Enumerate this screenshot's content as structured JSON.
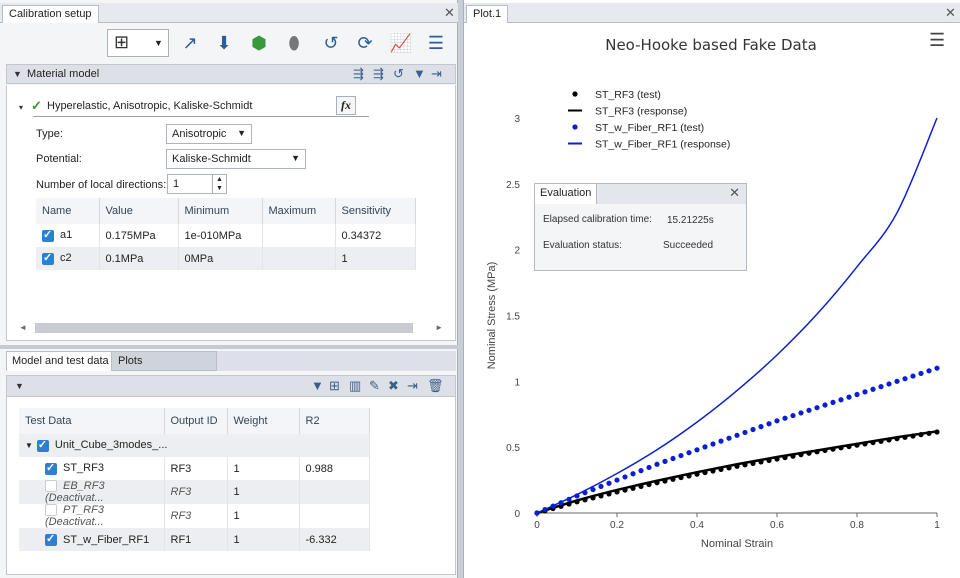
{
  "left_panel": {
    "tab_title": "Calibration setup",
    "material_model": {
      "section_title": "Material model",
      "model_name": "Hyperelastic, Anisotropic, Kaliske-Schmidt",
      "fx_label": "fx",
      "type_label": "Type:",
      "type_value": "Anisotropic",
      "potential_label": "Potential:",
      "potential_value": "Kaliske-Schmidt",
      "local_dirs_label": "Number of local directions:",
      "local_dirs_value": "1",
      "columns": [
        "Name",
        "Value",
        "Minimum",
        "Maximum",
        "Sensitivity"
      ],
      "rows": [
        {
          "name": "a1",
          "value": "0.175MPa",
          "minimum": "1e-010MPa",
          "maximum": "",
          "sensitivity": "0.34372"
        },
        {
          "name": "c2",
          "value": "0.1MPa",
          "minimum": "0MPa",
          "maximum": "",
          "sensitivity": "1"
        }
      ]
    },
    "bottom_tabs": [
      "Model and test data",
      "Plots"
    ],
    "test_data": {
      "columns": [
        "Test Data",
        "Output ID",
        "Weight",
        "R2"
      ],
      "group_name": "Unit_Cube_3modes_...",
      "rows": [
        {
          "name": "ST_RF3",
          "output": "RF3",
          "weight": "1",
          "r2": "0.988",
          "checked": true
        },
        {
          "name": "EB_RF3 (Deactivat...",
          "output": "RF3",
          "weight": "1",
          "r2": "",
          "checked": false
        },
        {
          "name": "PT_RF3 (Deactivat...",
          "output": "RF3",
          "weight": "1",
          "r2": "",
          "checked": false
        },
        {
          "name": "ST_w_Fiber_RF1",
          "output": "RF1",
          "weight": "1",
          "r2": "-6.332",
          "checked": true
        }
      ]
    }
  },
  "plot_panel": {
    "tab_title": "Plot.1",
    "menu_icon": "hamburger-menu-icon",
    "evaluation": {
      "title": "Evaluation",
      "elapsed_label": "Elapsed calibration time:",
      "elapsed_value": "15.21225s",
      "status_label": "Evaluation status:",
      "status_value": "Succeeded"
    }
  },
  "chart_data": {
    "type": "line",
    "title": "Neo-Hooke based Fake Data",
    "xlabel": "Nominal Strain",
    "ylabel": "Nominal Stress (MPa)",
    "xlim": [
      0,
      1
    ],
    "ylim": [
      0,
      3
    ],
    "xticks": [
      "0",
      "0.2",
      "0.4",
      "0.6",
      "0.8",
      "1"
    ],
    "yticks": [
      "0",
      "0.5",
      "1",
      "1.5",
      "2",
      "2.5",
      "3"
    ],
    "legend": "top-left",
    "series": [
      {
        "name": "ST_RF3 (test)",
        "style": "markers",
        "color": "#000000",
        "x": [
          0,
          0.1,
          0.2,
          0.3,
          0.4,
          0.5,
          0.6,
          0.7,
          0.8,
          0.9,
          1.0
        ],
        "y": [
          0,
          0.085,
          0.16,
          0.23,
          0.295,
          0.355,
          0.41,
          0.465,
          0.515,
          0.565,
          0.615
        ]
      },
      {
        "name": "ST_RF3 (response)",
        "style": "line",
        "color": "#000000",
        "x": [
          0,
          0.1,
          0.2,
          0.3,
          0.4,
          0.5,
          0.6,
          0.7,
          0.8,
          0.9,
          1.0
        ],
        "y": [
          0,
          0.095,
          0.175,
          0.245,
          0.31,
          0.37,
          0.425,
          0.475,
          0.525,
          0.575,
          0.62
        ]
      },
      {
        "name": "ST_w_Fiber_RF1 (test)",
        "style": "markers",
        "color": "#0a1fd0",
        "x": [
          0,
          0.1,
          0.2,
          0.3,
          0.4,
          0.5,
          0.6,
          0.7,
          0.8,
          0.9,
          1.0
        ],
        "y": [
          0,
          0.13,
          0.25,
          0.37,
          0.48,
          0.59,
          0.7,
          0.8,
          0.9,
          1.0,
          1.1
        ]
      },
      {
        "name": "ST_w_Fiber_RF1 (response)",
        "style": "line",
        "color": "#0a1fd0",
        "x": [
          0,
          0.1,
          0.2,
          0.3,
          0.4,
          0.5,
          0.6,
          0.7,
          0.8,
          0.9,
          1.0
        ],
        "y": [
          0,
          0.14,
          0.3,
          0.48,
          0.69,
          0.93,
          1.2,
          1.51,
          1.87,
          2.28,
          3.0
        ]
      }
    ]
  }
}
